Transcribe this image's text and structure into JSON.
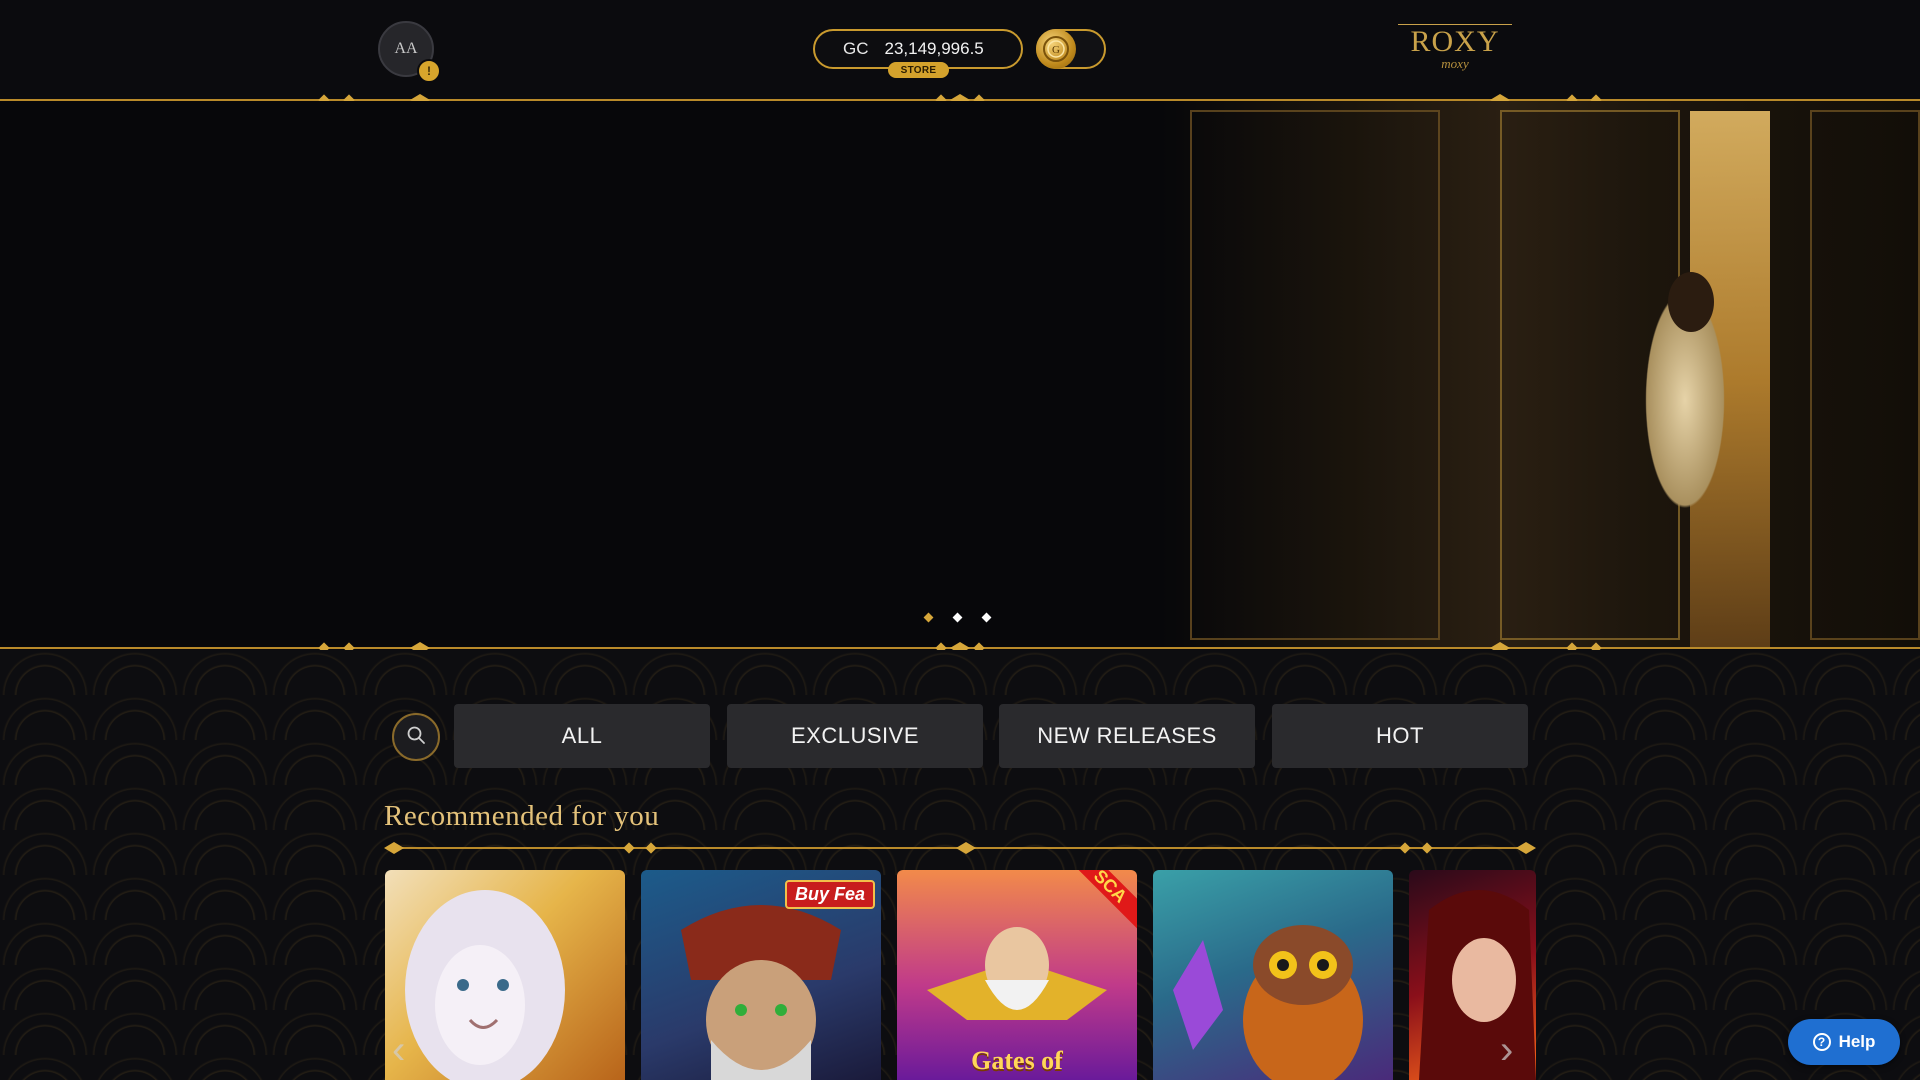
{
  "header": {
    "avatar_initials": "AA",
    "avatar_badge": "!",
    "balance_currency": "GC",
    "balance_amount": "23,149,996.5",
    "store_label": "STORE",
    "coin_icon": "gold-coin-icon"
  },
  "logo": {
    "top_text": "ROXY",
    "bottom_text": "moxy"
  },
  "hero": {
    "slide_count": 3,
    "active_slide": 1
  },
  "filters": {
    "search_icon": "search-icon",
    "tabs": [
      "ALL",
      "EXCLUSIVE",
      "NEW RELEASES",
      "HOT"
    ]
  },
  "recommended": {
    "title": "Recommended for you",
    "games": [
      {
        "label": "",
        "colors": [
          "#f0b22c",
          "#c26b12"
        ]
      },
      {
        "label": "",
        "badge": "Buy Fea",
        "colors": [
          "#1b4e7a",
          "#3a2a6a"
        ]
      },
      {
        "label": "Gates of",
        "badge": "SCA",
        "colors": [
          "#e7563c",
          "#7a1f96"
        ]
      },
      {
        "label": "",
        "colors": [
          "#2b7f8a",
          "#6b2aa0"
        ]
      },
      {
        "label": "",
        "colors": [
          "#8a0f1a",
          "#ff6a1a"
        ]
      }
    ]
  },
  "help": {
    "label": "Help"
  },
  "colors": {
    "gold": "#c99a2e",
    "background": "#0a0a0d",
    "help_blue": "#1f6fd1"
  }
}
